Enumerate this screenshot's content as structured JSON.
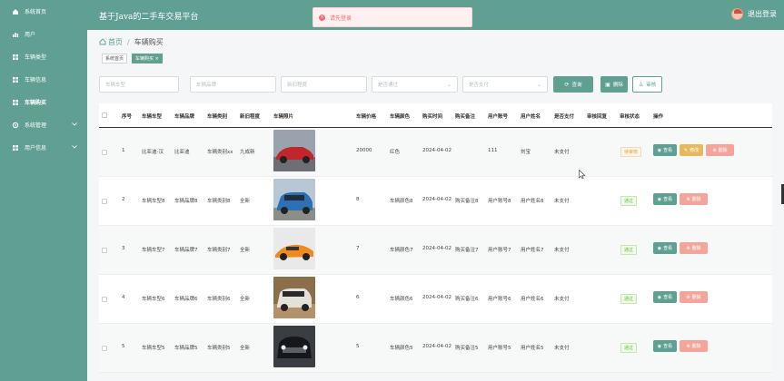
{
  "header": {
    "title": "基于Java的二手车交易平台",
    "logout": "退出登录"
  },
  "toast": {
    "message": "请先登录"
  },
  "sidebar": {
    "items": [
      {
        "label": "系统首页",
        "icon": "home-icon"
      },
      {
        "label": "用户",
        "icon": "chart-icon"
      },
      {
        "label": "车辆类型",
        "icon": "grid-icon"
      },
      {
        "label": "车辆信息",
        "icon": "grid-icon"
      },
      {
        "label": "车辆购买",
        "icon": "grid-icon"
      },
      {
        "label": "系统管理",
        "icon": "gear-icon"
      },
      {
        "label": "用户信息",
        "icon": "grid-icon"
      }
    ]
  },
  "breadcrumb": {
    "home": "首页",
    "current": "车辆购买"
  },
  "tabs": [
    {
      "label": "系统首页"
    },
    {
      "label": "车辆购买 ×"
    }
  ],
  "filters": {
    "type_placeholder": "车辆车型",
    "brand_placeholder": "车辆品牌",
    "condition_placeholder": "新旧程度",
    "approved_placeholder": "是否通过",
    "paid_placeholder": "是否支付",
    "query": "查询",
    "delete": "删除",
    "audit": "审核"
  },
  "table": {
    "headers": [
      "序号",
      "车辆车型",
      "车辆品牌",
      "车辆类别",
      "新旧程度",
      "车辆照片",
      "车辆价格",
      "车辆颜色",
      "购买时间",
      "购买备注",
      "用户账号",
      "用户姓名",
      "是否支付",
      "审核回复",
      "审核状态",
      "操作"
    ],
    "actions": {
      "view": "查看",
      "edit": "修改",
      "delete": "删除"
    },
    "rows": [
      {
        "no": "1",
        "model": "比亚迪-汉",
        "brand": "比亚迪",
        "category": "车辆类别xx",
        "condition": "九成新",
        "price": "20000",
        "color": "红色",
        "time": "2024-04-02",
        "note": "",
        "account": "111",
        "username": "刘宝",
        "paid": "未支付",
        "reply": "",
        "status": "待审核",
        "status_kind": "pending",
        "editable": true
      },
      {
        "no": "2",
        "model": "车辆车型8",
        "brand": "车辆品牌8",
        "category": "车辆类别8",
        "condition": "全新",
        "price": "8",
        "color": "车辆颜色8",
        "time": "2024-04-02",
        "note": "购买备注8",
        "account": "用户账号8",
        "username": "用户姓名8",
        "paid": "未支付",
        "reply": "",
        "status": "通过",
        "status_kind": "passed",
        "editable": false
      },
      {
        "no": "3",
        "model": "车辆车型7",
        "brand": "车辆品牌7",
        "category": "车辆类别7",
        "condition": "全新",
        "price": "7",
        "color": "车辆颜色7",
        "time": "2024-04-02",
        "note": "购买备注7",
        "account": "用户账号7",
        "username": "用户姓名7",
        "paid": "未支付",
        "reply": "",
        "status": "通过",
        "status_kind": "passed",
        "editable": false
      },
      {
        "no": "4",
        "model": "车辆车型6",
        "brand": "车辆品牌6",
        "category": "车辆类别6",
        "condition": "全新",
        "price": "6",
        "color": "车辆颜色6",
        "time": "2024-04-02",
        "note": "购买备注6",
        "account": "用户账号6",
        "username": "用户姓名6",
        "paid": "未支付",
        "reply": "",
        "status": "通过",
        "status_kind": "passed",
        "editable": false
      },
      {
        "no": "5",
        "model": "车辆车型5",
        "brand": "车辆品牌5",
        "category": "车辆类别5",
        "condition": "全新",
        "price": "5",
        "color": "车辆颜色5",
        "time": "2024-04-02",
        "note": "购买备注5",
        "account": "用户账号5",
        "username": "用户姓名5",
        "paid": "未支付",
        "reply": "",
        "status": "通过",
        "status_kind": "passed",
        "editable": false
      }
    ]
  },
  "colors": {
    "theme": "#5fa092",
    "edit": "#e6b95f",
    "delete": "#f4a59b",
    "error": "#f56c6c"
  }
}
